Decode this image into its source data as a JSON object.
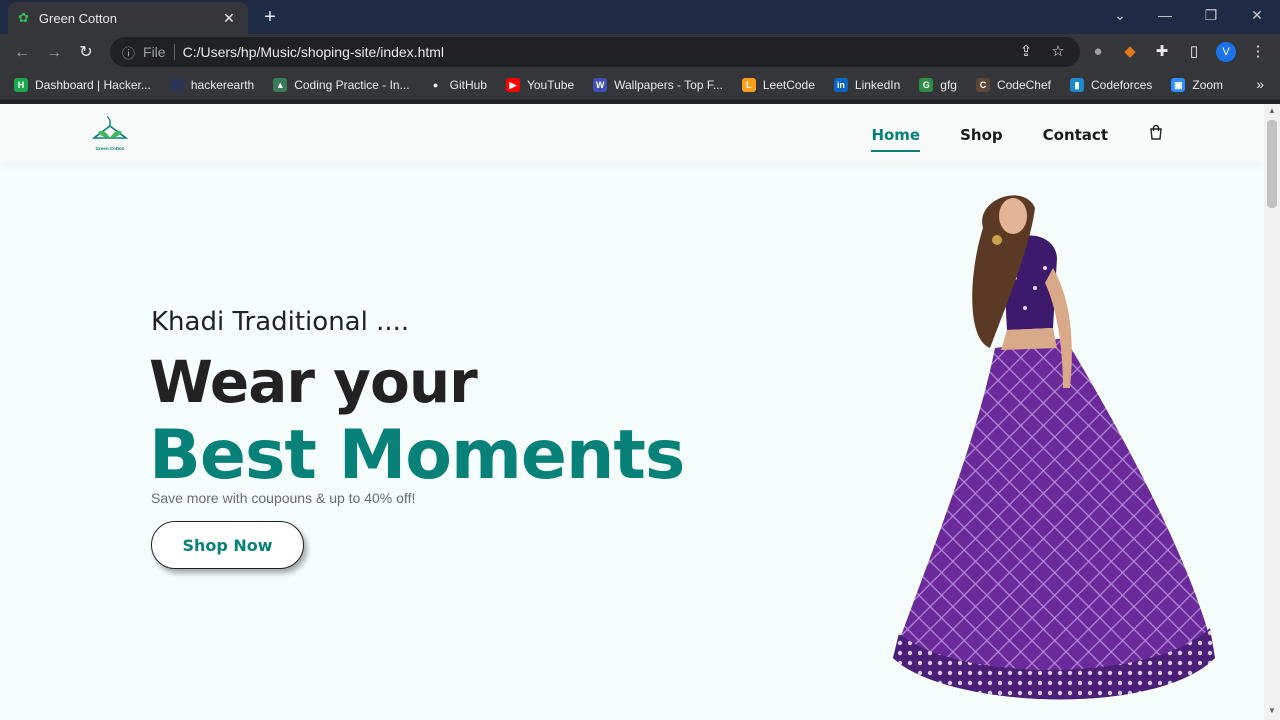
{
  "browser": {
    "tab_title": "Green Cotton",
    "tab_close": "✕",
    "new_tab": "+",
    "url_prefix": "File",
    "url": "C:/Users/hp/Music/shoping-site/index.html",
    "profile_initial": "V",
    "bookmarks": [
      {
        "label": "Dashboard | Hacker...",
        "icon": "hackerrank-icon",
        "color": "#1ba94c",
        "glyph": "H"
      },
      {
        "label": "hackerearth",
        "icon": "hackerearth-icon",
        "color": "#2c3454",
        "glyph": ""
      },
      {
        "label": "Coding Practice - In...",
        "icon": "mountain-icon",
        "color": "#3b7a57",
        "glyph": "▲"
      },
      {
        "label": "GitHub",
        "icon": "github-icon",
        "color": "#ffffff",
        "glyph": "●"
      },
      {
        "label": "YouTube",
        "icon": "youtube-icon",
        "color": "#ff0000",
        "glyph": "▶"
      },
      {
        "label": "Wallpapers - Top F...",
        "icon": "wallpapers-icon",
        "color": "#3f51b5",
        "glyph": "W"
      },
      {
        "label": "LeetCode",
        "icon": "leetcode-icon",
        "color": "#f89f1b",
        "glyph": "L"
      },
      {
        "label": "LinkedIn",
        "icon": "linkedin-icon",
        "color": "#0a66c2",
        "glyph": "in"
      },
      {
        "label": "gfg",
        "icon": "gfg-icon",
        "color": "#2f8d46",
        "glyph": "G"
      },
      {
        "label": "CodeChef",
        "icon": "codechef-icon",
        "color": "#5b4638",
        "glyph": "C"
      },
      {
        "label": "Codeforces",
        "icon": "codeforces-icon",
        "color": "#1f8acb",
        "glyph": "▮"
      },
      {
        "label": "Zoom",
        "icon": "zoom-icon",
        "color": "#2d8cff",
        "glyph": "▣"
      }
    ],
    "bookmarks_more": "»"
  },
  "site": {
    "brand": "Green Cotton",
    "nav": [
      {
        "label": "Home",
        "active": true
      },
      {
        "label": "Shop",
        "active": false
      },
      {
        "label": "Contact",
        "active": false
      }
    ],
    "accent_color": "#088178"
  },
  "hero": {
    "subtitle": "Khadi Traditional ....",
    "title_line1": "Wear your",
    "title_line2": "Best Moments",
    "promo": "Save more with coupouns & up to 40% off!",
    "cta": "Shop Now"
  }
}
